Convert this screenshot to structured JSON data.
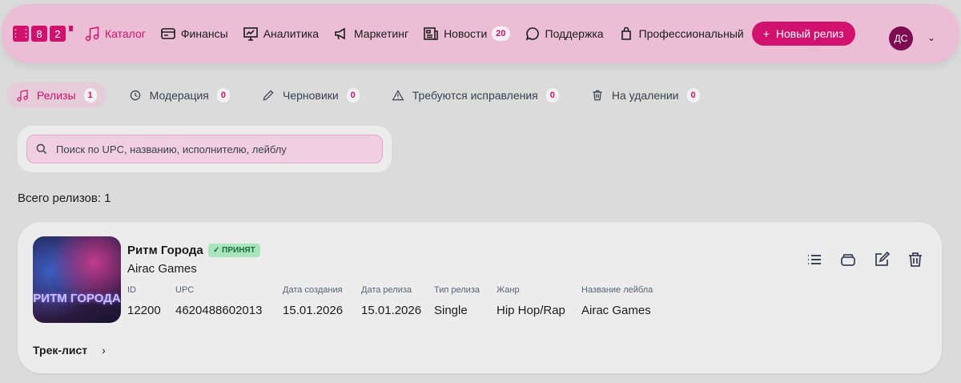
{
  "header": {
    "logo": [
      "⋮⋮",
      "8",
      "2"
    ],
    "nav": [
      {
        "label": "Каталог",
        "icon": "music-note-icon"
      },
      {
        "label": "Финансы",
        "icon": "card-icon"
      },
      {
        "label": "Аналитика",
        "icon": "chart-icon"
      },
      {
        "label": "Маркетинг",
        "icon": "megaphone-icon"
      },
      {
        "label": "Новости",
        "icon": "news-icon",
        "badge": "20"
      },
      {
        "label": "Поддержка",
        "icon": "chat-icon"
      },
      {
        "label": "Профессиональный",
        "icon": "bag-icon"
      }
    ],
    "new_release": "Новый релиз",
    "avatar": "ДС"
  },
  "tabs": [
    {
      "label": "Релизы",
      "count": "1"
    },
    {
      "label": "Модерация",
      "count": "0"
    },
    {
      "label": "Черновики",
      "count": "0"
    },
    {
      "label": "Требуются исправления",
      "count": "0"
    },
    {
      "label": "На удалении",
      "count": "0"
    }
  ],
  "search": {
    "placeholder": "Поиск по UPC, названию, исполнителю, лейблу"
  },
  "total": "Всего релизов: 1",
  "release": {
    "cover_text": "РИТМ ГОРОДА",
    "title": "Ритм Города",
    "status": "✓ ПРИНЯТ",
    "artist": "Airac Games",
    "fields": [
      {
        "label": "ID",
        "value": "12200"
      },
      {
        "label": "UPC",
        "value": "4620488602013"
      },
      {
        "label": "Дата создания",
        "value": "15.01.2026"
      },
      {
        "label": "Дата релиза",
        "value": "15.01.2026"
      },
      {
        "label": "Тип релиза",
        "value": "Single"
      },
      {
        "label": "Жанр",
        "value": "Hip Hop/Rap"
      },
      {
        "label": "Название лейбла",
        "value": "Airac Games"
      }
    ],
    "tracklist": "Трек-лист"
  },
  "colors": {
    "accent": "#d0126e",
    "header": "#ebbed6"
  }
}
